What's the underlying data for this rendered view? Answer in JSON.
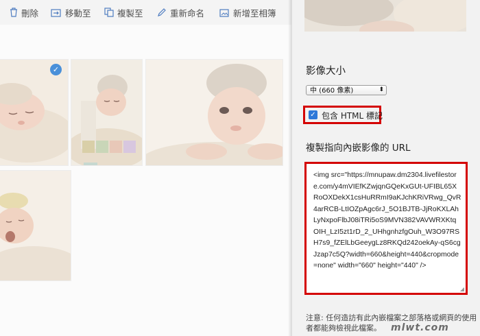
{
  "toolbar": {
    "delete": "刪除",
    "move": "移動至",
    "copy": "複製至",
    "rename": "重新命名",
    "add_album": "新增至相簿"
  },
  "panel": {
    "size_heading": "影像大小",
    "size_value": "中 (660 像素)",
    "checkbox_label": "包含 HTML 標記",
    "url_heading": "複製指向內嵌影像的 URL",
    "embed_code": "<img src=\"https://mnupaw.dm2304.livefilestore.com/y4mVIEfKZwjqnGQeKxGUt-UFIBL65XRoOXDekX1csHuRRmI9aKJchKRiVRwg_QvR4arRCB-LtIOZpAgc6rJ_5O1BJTB-JjRoKXLAhLyNxpoFlbJ08iTRi5oS9MVN382VAVWRXKtqOIH_LzI5zt1rD_2_UHhgnhzfgOuh_W3O97RSH7s9_fZElLbGeeygLz8RKQd242oekAy-qS6cgJzap7c5Q?width=660&height=440&cropmode=none\" width=\"660\" height=\"440\" />",
    "note": "注意: 任何造訪有此內嵌檔案之部落格或網頁的使用者都能夠檢視此檔案。"
  },
  "watermark": "mlwt.com",
  "colors": {
    "accent": "#2e78d8",
    "highlight_border": "#d40000",
    "selected_check": "#4a90d9"
  }
}
